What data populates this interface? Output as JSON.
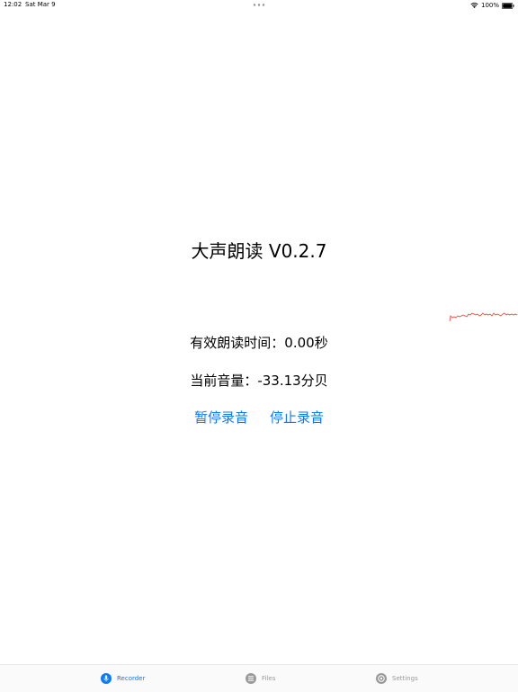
{
  "status_bar": {
    "time": "12:02",
    "date": "Sat Mar 9",
    "battery": "100%"
  },
  "main": {
    "title": "大声朗读 V0.2.7",
    "duration_text": "有效朗读时间：0.00秒",
    "volume_text": "当前音量：-33.13分贝",
    "pause_label": "暂停录音",
    "stop_label": "停止录音"
  },
  "tab_bar": {
    "items": [
      {
        "label": "Recorder",
        "icon": "mic-icon"
      },
      {
        "label": "Files",
        "icon": "list-icon"
      },
      {
        "label": "Settings",
        "icon": "gear-icon"
      }
    ]
  },
  "colors": {
    "accent": "#0a7aff",
    "waveform": "#e8443a",
    "inactive_tab": "#999999"
  }
}
